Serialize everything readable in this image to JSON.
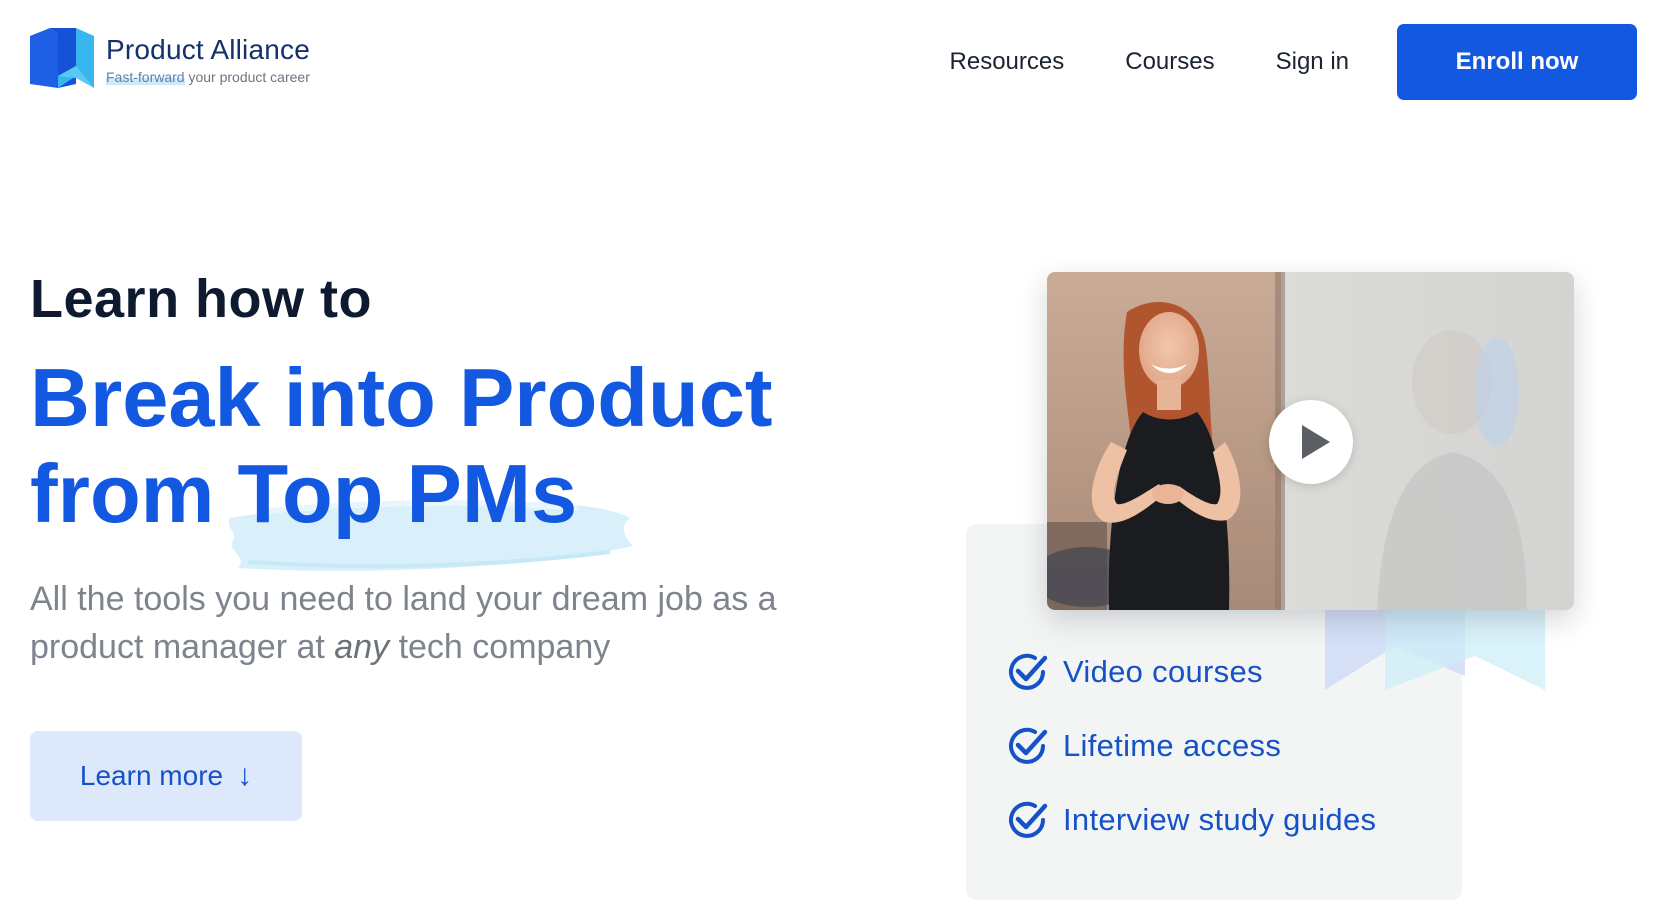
{
  "brand": {
    "name": "Product Alliance",
    "tagline_highlight": "Fast-forward",
    "tagline_rest": " your product career",
    "primary_color": "#1358e0"
  },
  "nav": {
    "resources": "Resources",
    "courses": "Courses",
    "sign_in": "Sign in",
    "enroll": "Enroll now"
  },
  "hero": {
    "kicker": "Learn how to",
    "title_line1": "Break into Product",
    "title_line2_a": "from ",
    "title_line2_b": "Top PMs",
    "subtitle_a": "All the tools you need to land your dream job as a product manager at ",
    "subtitle_em": "any",
    "subtitle_b": " tech company",
    "cta": "Learn more",
    "cta_icon": "arrow-down-icon"
  },
  "video": {
    "icon": "play-icon"
  },
  "features": [
    {
      "label": "Video courses",
      "icon": "check-circle-icon"
    },
    {
      "label": "Lifetime access",
      "icon": "check-circle-icon"
    },
    {
      "label": "Interview study guides",
      "icon": "check-circle-icon"
    }
  ]
}
